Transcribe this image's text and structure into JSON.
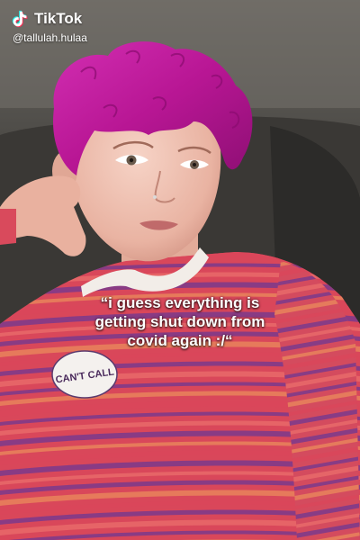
{
  "watermark": {
    "brand": "TikTok",
    "handle": "@tallulah.hulaa",
    "icon": "tiktok-logo-icon"
  },
  "caption": {
    "lines": [
      "“i guess everything is",
      "getting shut down from",
      "covid again :/“"
    ]
  },
  "sticker": {
    "text": "CAN'T CALL"
  },
  "colors": {
    "hair": "#c21ea0",
    "shirt_base": "#d9475a",
    "shirt_stripe_purple": "#7a3a8c",
    "shirt_stripe_orange": "#e8845c",
    "background_seat": "#2f2e2b",
    "caption_text": "#ffffff"
  }
}
